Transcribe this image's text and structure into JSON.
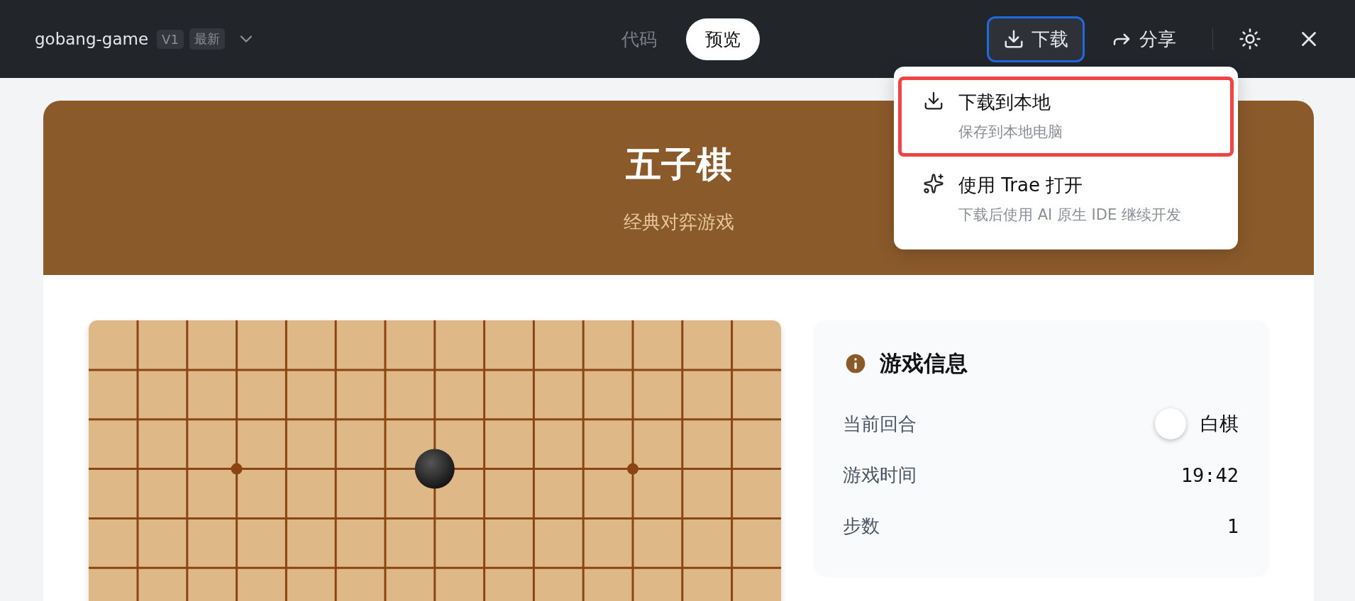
{
  "header": {
    "title": "gobang-game",
    "badges": [
      "V1",
      "最新"
    ],
    "tabs": [
      {
        "label": "代码",
        "selected": false
      },
      {
        "label": "预览",
        "selected": true
      }
    ],
    "actions": [
      {
        "kind": "download",
        "label": "下载",
        "selected": true
      },
      {
        "kind": "share",
        "label": "分享",
        "selected": false
      }
    ]
  },
  "dropdown": {
    "items": [
      {
        "kind": "local",
        "title": "下载到本地",
        "subtitle": "保存到本地电脑",
        "selected": true
      },
      {
        "kind": "trae",
        "title": "使用 Trae 打开",
        "subtitle": "下载后使用 AI 原生 IDE 继续开发",
        "selected": false
      }
    ]
  },
  "game": {
    "title": "五子棋",
    "subtitle": "经典对弈游戏",
    "info": {
      "title": "游戏信息",
      "rows": [
        {
          "kind": "turn",
          "label": "当前回合",
          "value": "白棋"
        },
        {
          "kind": "text",
          "label": "游戏时间",
          "value": "19:42"
        },
        {
          "kind": "text",
          "label": "步数",
          "value": "1"
        }
      ]
    }
  }
}
